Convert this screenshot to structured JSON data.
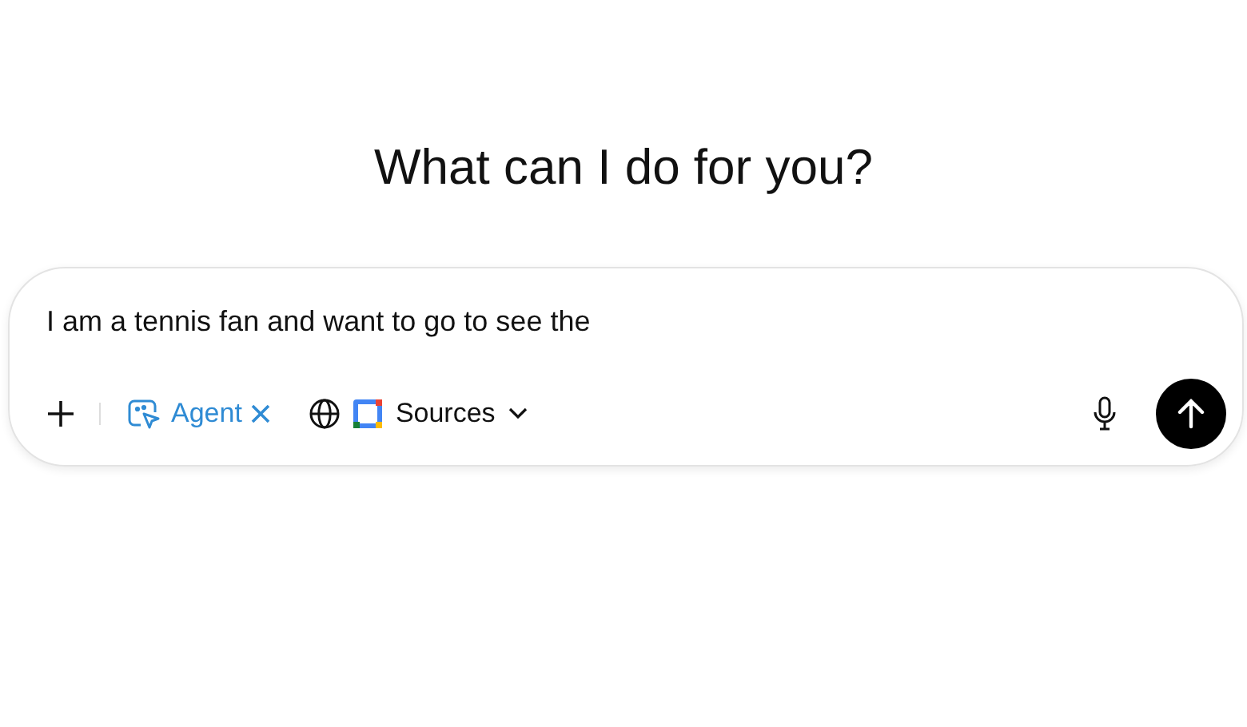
{
  "heading": "What can I do for you?",
  "prompt": {
    "value": "I am a tennis fan and want to go to see the"
  },
  "toolbar": {
    "agent_chip": {
      "label": "Agent",
      "removable": true
    },
    "sources": {
      "label": "Sources"
    }
  }
}
